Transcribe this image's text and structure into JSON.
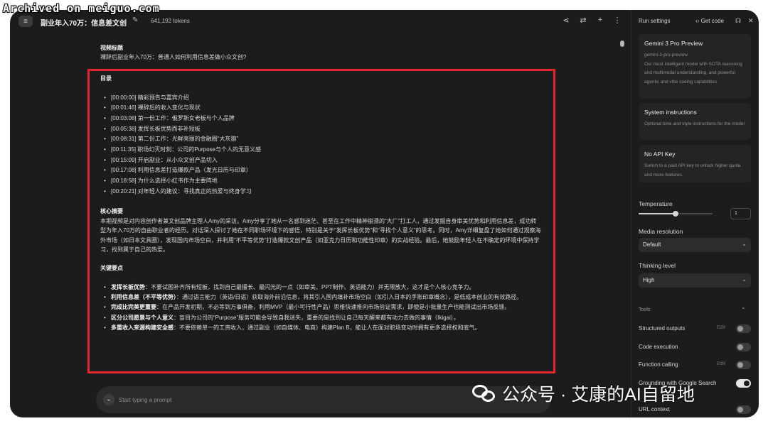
{
  "watermark_top": "Archived on meiguo.com",
  "header": {
    "title": "副业年入70万：信息差文创",
    "tokens": "641,192 tokens"
  },
  "chat": {
    "video_label": "视频标题",
    "video_title": "裸辞后副业年入70万：普通人如何利用信息差做小众文创?",
    "toc_title": "目录",
    "toc": [
      "[00:00:00] 精彩预告与嘉宾介绍",
      "[00:01:46] 裸辞后的收入变化与现状",
      "[00:03:08] 第一份工作：俄罗斯女老板与个人品牌",
      "[00:05:38] 发挥长板优势而非补短板",
      "[00:08:31] 第二份工作：光鲜亮丽的金融圈“大灰狼”",
      "[00:11:35] 职场幻灭时刻：公司的Purpose与个人的无意义感",
      "[00:15:09] 开启副业：从小众文创产品切入",
      "[00:17:08] 利用信息差打造爆款产品（发光日历与印章）",
      "[00:18:58] 为什么选择小红书作为主要阵地",
      "[00:20:21] 对年轻人的建议：寻找真正的热爱与终身学习"
    ],
    "summary_title": "核心摘要",
    "summary": "本期视频是对内容创作者兼文创品牌主理人Amy的采访。Amy分享了她从一名感到迷茫、甚至在工作中精神崩溃的“大厂”打工人，通过发掘自身审美优势和利用信息差，成功转型为年入70万的自由职业者的经历。对话深入探讨了她在不同职场环境下的感悟，特别是关于“发挥长板优势”和“寻找个人意义”的思考。同时，Amy详细复盘了她如何通过观察海外市场（如日本文具圈），发现国内市场空白，并利用“不平等优势”打造爆款文创产品（如亚克力日历和功能性印章）的实战经验。最后，她鼓励年轻人在不确定的环境中保持学习，找到属于自己的热爱。",
    "key_title": "关键要点",
    "key_points": [
      {
        "bold": "发挥长板优势",
        "text": "：不要试图补齐所有短板，找到自己最擅长、最闪光的一点（如审美、PPT制作、英语能力）并无限放大，这才是个人核心竞争力。"
      },
      {
        "bold": "利用信息差（不平等优势）",
        "text": "：通过语言能力（英语/日语）获取海外前沿信息，将其引入国内填补市场空白（如引入日本的手账印章概念），是低成本创业的有效路径。"
      },
      {
        "bold": "完成比完美更重要",
        "text": "：在产品开发初期，不必等到万事俱备，利用MVP（最小可行性产品）思维快速推向市场验证需求，即使是小批量生产也能测试出市场反馈。"
      },
      {
        "bold": "区分公司愿景与个人意义",
        "text": "：盲目为公司的“Purpose”服务可能会导致自我迷失，重要的是找到让自己每天醒来都有动力去做的事情（Ikigai）。"
      },
      {
        "bold": "多重收入来源构建安全感",
        "text": "：不要依赖单一的工资收入，通过副业（如自媒体、电商）构建Plan B，能让人在面对职场变动时拥有更多选择权和底气。"
      }
    ],
    "prompt_placeholder": "Start typing a prompt"
  },
  "sidepanel": {
    "run_settings": "Run settings",
    "get_code": "Get code",
    "model": {
      "name": "Gemini 3 Pro Preview",
      "id": "gemini-3-pro-preview",
      "desc": "Our most intelligent model with SOTA reasoning and multimodal understanding, and powerful agentic and vibe coding capabilities"
    },
    "system": {
      "title": "System instructions",
      "desc": "Optional tone and style instructions for the model"
    },
    "api": {
      "title": "No API Key",
      "desc": "Switch to a paid API key to unlock higher quota and more features."
    },
    "temperature_label": "Temperature",
    "temperature_value": "1",
    "temperature_fraction": 0.5,
    "media_label": "Media resolution",
    "media_value": "Default",
    "thinking_label": "Thinking level",
    "thinking_value": "High",
    "tools_label": "Tools",
    "tools": [
      {
        "name": "Structured outputs",
        "edit": "Edit",
        "on": false
      },
      {
        "name": "Code execution",
        "edit": "",
        "on": false
      },
      {
        "name": "Function calling",
        "edit": "Edit",
        "on": false
      },
      {
        "name": "Grounding with Google Search",
        "edit": "",
        "on": true
      },
      {
        "name": "URL context",
        "edit": "",
        "on": false
      }
    ]
  },
  "wechat_watermark": "公众号 · 艾康的AI自留地",
  "colors": {
    "background": "#1b1c1e",
    "highlight": "#e3252c"
  }
}
